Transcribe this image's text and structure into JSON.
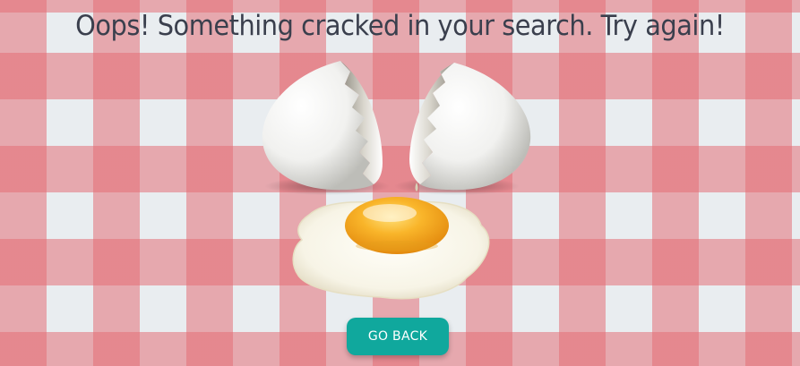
{
  "page": {
    "headline": "Oops! Something cracked in your search. Try again!",
    "button_label": "GO BACK"
  },
  "theme": {
    "background": "#e9edf0",
    "gingham_stripe": "#e46a72",
    "headline_color": "#3a3f4d",
    "button_color": "#10a89d",
    "button_text_color": "#ffffff",
    "yolk_color": "#f6a91e",
    "egg_white_color": "#fbfaf3"
  },
  "illustration": {
    "icon": "cracked-egg-icon"
  }
}
